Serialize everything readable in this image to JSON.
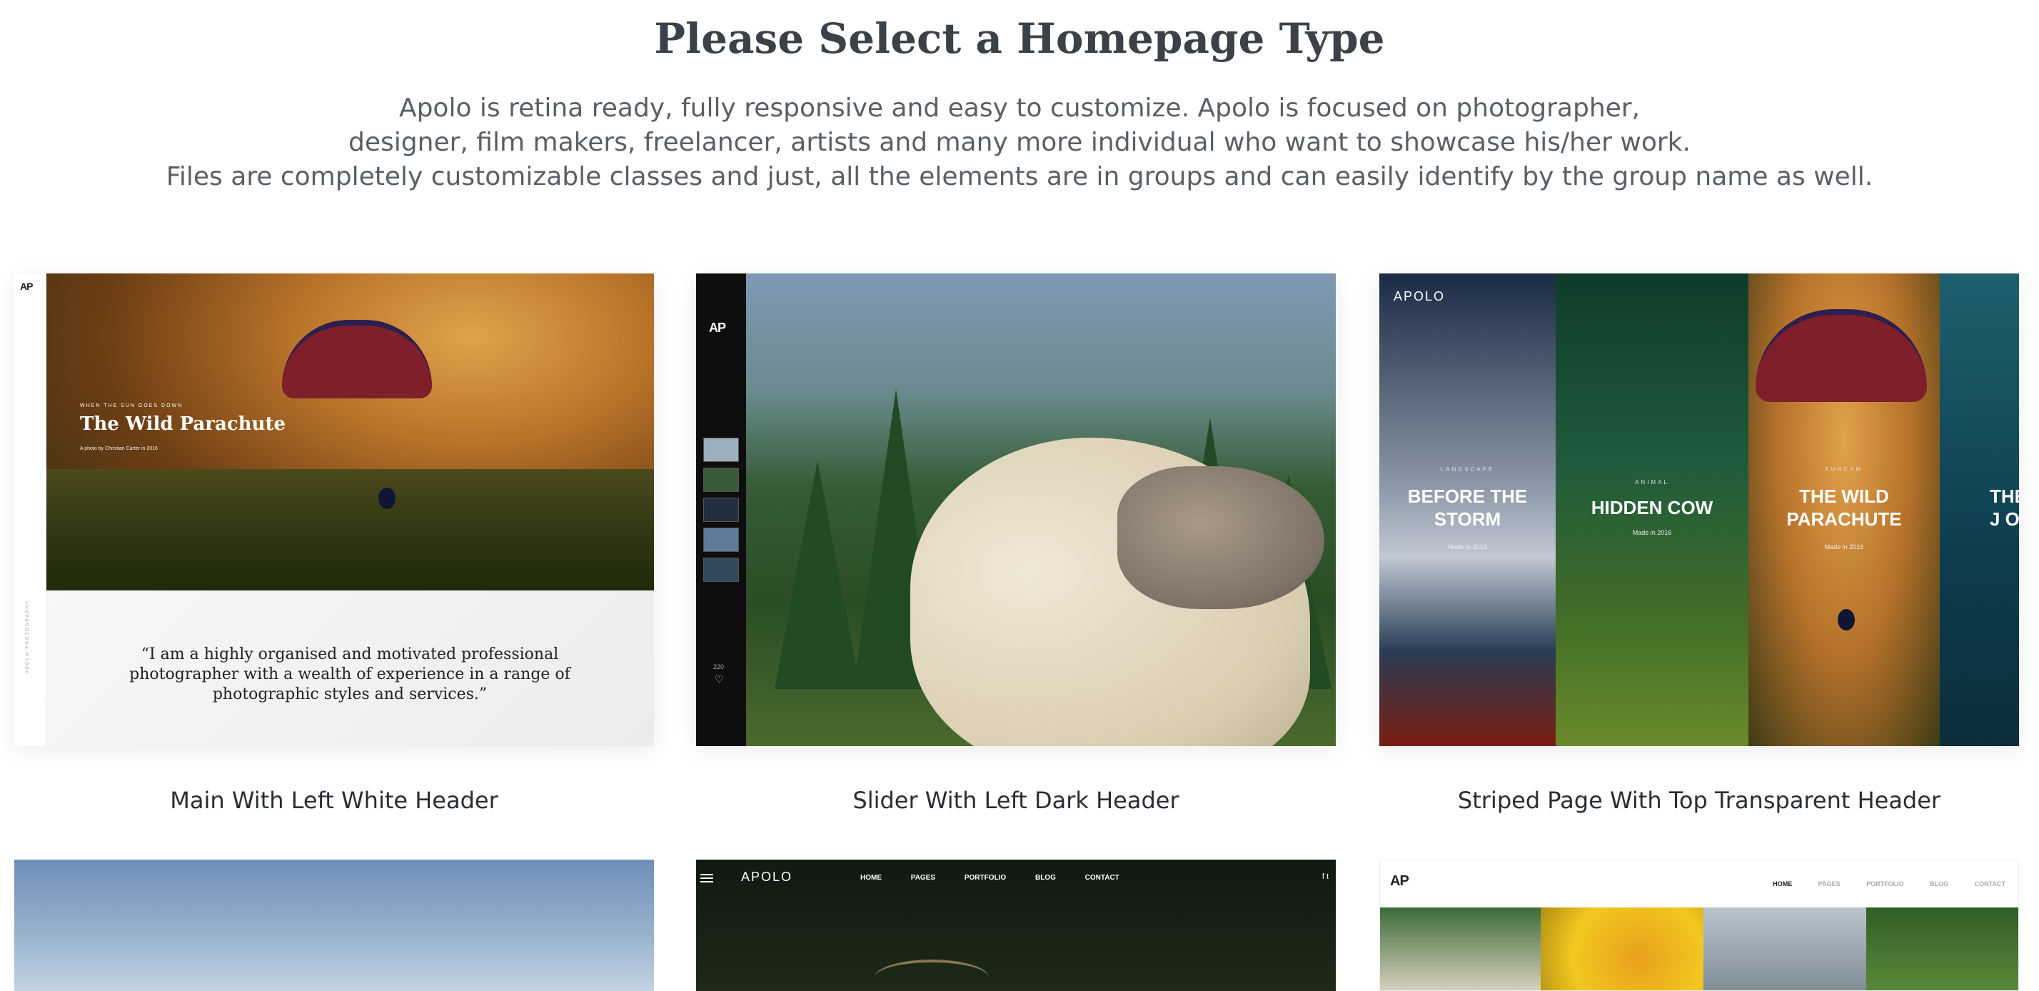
{
  "header": {
    "title": "Please Select a Homepage Type",
    "description_lines": [
      "Apolo is retina ready, fully responsive and easy to customize. Apolo is focused on photographer,",
      "designer, film makers, freelancer, artists and many more individual who want to showcase his/her work.",
      "Files are completely customizable classes and just, all the elements are in groups and can easily identify by the group name as well."
    ]
  },
  "cards": [
    {
      "caption": "Main With Left White Header",
      "preview": {
        "logo": "AP",
        "vertical_text": "APOLO PHOTOGRAPHY",
        "kicker": "WHEN THE SUN GOES DOWN",
        "title": "The Wild Parachute",
        "credit": "A photo by Christian Carter in 2016",
        "quote": "“I am a highly organised and motivated professional photographer with a wealth of experience in a range of photographic styles and services.”"
      }
    },
    {
      "caption": "Slider With Left Dark Header",
      "preview": {
        "logo": "AP",
        "likes": "220"
      }
    },
    {
      "caption": "Striped Page With Top Transparent Header",
      "preview": {
        "logo": "APOLO",
        "strips": [
          {
            "kicker": "LANDSCAPE",
            "title": "BEFORE THE STORM",
            "made": "Made in 2016"
          },
          {
            "kicker": "ANIMAL",
            "title": "HIDDEN COW",
            "made": "Made in 2016"
          },
          {
            "kicker": "FUNCAM",
            "title": "THE WILD PARACHUTE",
            "made": "Made in 2016"
          },
          {
            "kicker": "",
            "title": "THE J O",
            "made": ""
          }
        ]
      }
    }
  ],
  "row2": [
    {},
    {
      "logo": "APOLO",
      "nav": [
        "HOME",
        "PAGES",
        "PORTFOLIO",
        "BLOG",
        "CONTACT"
      ],
      "social": "f  t"
    },
    {
      "logo": "AP",
      "nav": [
        "HOME",
        "PAGES",
        "PORTFOLIO",
        "BLOG",
        "CONTACT"
      ]
    }
  ],
  "colors": {
    "title": "#3c4148",
    "text": "#5a5f65",
    "caption": "#2a2d31"
  }
}
